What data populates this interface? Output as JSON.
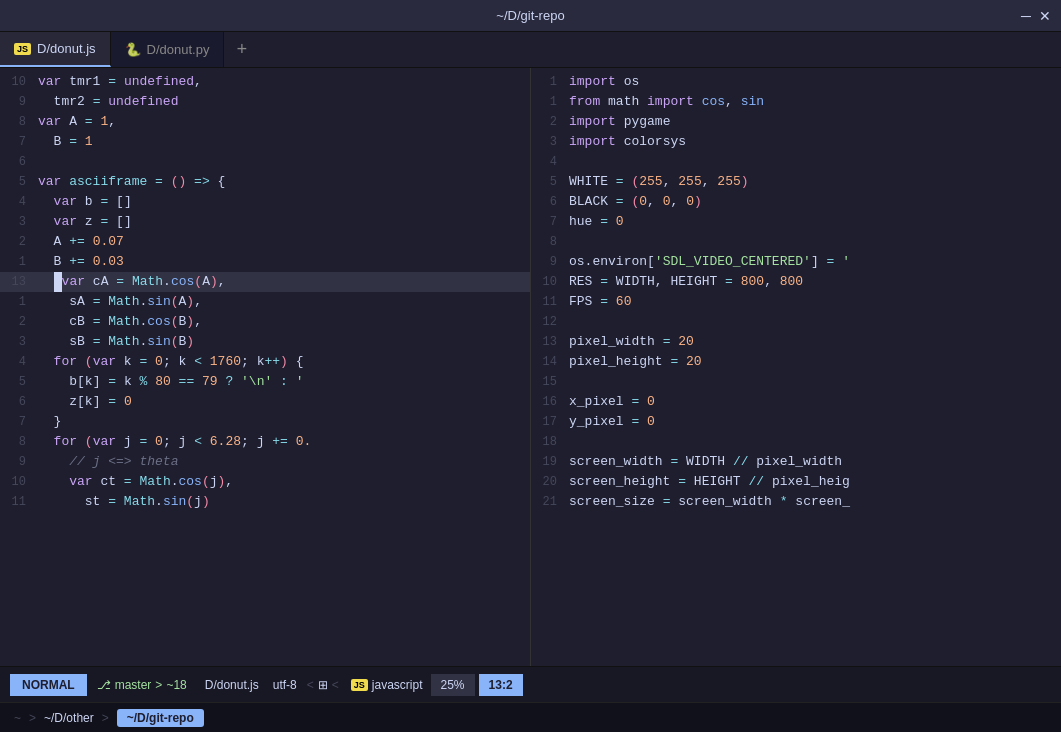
{
  "window": {
    "title": "~/D/git-repo",
    "minimize": "─",
    "close": "✕"
  },
  "tabs": [
    {
      "id": "js-tab",
      "icon": "JS",
      "label": "D/donut.js",
      "active": true
    },
    {
      "id": "py-tab",
      "icon": "🐍",
      "label": "D/donut.py",
      "active": false
    },
    {
      "id": "plus",
      "label": "+"
    }
  ],
  "left_pane": {
    "lines": [
      {
        "num": "10",
        "content": "var tmr1 = undefined,"
      },
      {
        "num": "9",
        "content": "  tmr2 = undefined"
      },
      {
        "num": "8",
        "content": "var A = 1,"
      },
      {
        "num": "7",
        "content": "  B = 1"
      },
      {
        "num": "6",
        "content": ""
      },
      {
        "num": "5",
        "content": "var asciiframe = () => {"
      },
      {
        "num": "4",
        "content": "  var b = []"
      },
      {
        "num": "3",
        "content": "  var z = []"
      },
      {
        "num": "2",
        "content": "  A += 0.07"
      },
      {
        "num": "1",
        "content": "  B += 0.03"
      },
      {
        "num": "13",
        "content": "  var cA = Math.cos(A),",
        "highlight": true
      },
      {
        "num": "1",
        "content": "    sA = Math.sin(A),"
      },
      {
        "num": "2",
        "content": "    cB = Math.cos(B),"
      },
      {
        "num": "3",
        "content": "    sB = Math.sin(B)"
      },
      {
        "num": "4",
        "content": "  for (var k = 0; k < 1760; k++) {"
      },
      {
        "num": "5",
        "content": "    b[k] = k % 80 == 79 ? '\\n' : '"
      },
      {
        "num": "6",
        "content": "    z[k] = 0"
      },
      {
        "num": "7",
        "content": "  }"
      },
      {
        "num": "8",
        "content": "  for (var j = 0; j < 6.28; j += 0."
      },
      {
        "num": "9",
        "content": "    // j <=> theta"
      },
      {
        "num": "10",
        "content": "    var ct = Math.cos(j),"
      },
      {
        "num": "11",
        "content": "      st = Math.sin(j)"
      }
    ]
  },
  "right_pane": {
    "lines": [
      {
        "num": "1",
        "content": "import os"
      },
      {
        "num": "1",
        "content": "from math import cos, sin"
      },
      {
        "num": "2",
        "content": "import pygame"
      },
      {
        "num": "3",
        "content": "import colorsys"
      },
      {
        "num": "4",
        "content": ""
      },
      {
        "num": "5",
        "content": "WHITE = (255, 255, 255)"
      },
      {
        "num": "6",
        "content": "BLACK = (0, 0, 0)"
      },
      {
        "num": "7",
        "content": "hue = 0"
      },
      {
        "num": "8",
        "content": ""
      },
      {
        "num": "9",
        "content": "os.environ['SDL_VIDEO_CENTERED'] = '"
      },
      {
        "num": "10",
        "content": "RES = WIDTH, HEIGHT = 800, 800"
      },
      {
        "num": "11",
        "content": "FPS = 60"
      },
      {
        "num": "12",
        "content": ""
      },
      {
        "num": "13",
        "content": "pixel_width = 20"
      },
      {
        "num": "14",
        "content": "pixel_height = 20"
      },
      {
        "num": "15",
        "content": ""
      },
      {
        "num": "16",
        "content": "x_pixel = 0"
      },
      {
        "num": "17",
        "content": "y_pixel = 0"
      },
      {
        "num": "18",
        "content": ""
      },
      {
        "num": "19",
        "content": "screen_width = WIDTH // pixel_width"
      },
      {
        "num": "20",
        "content": "screen_height = HEIGHT // pixel_heig"
      },
      {
        "num": "21",
        "content": "screen_size = screen_width * screen_"
      }
    ]
  },
  "status": {
    "mode": "NORMAL",
    "git_icon": "⎇",
    "branch": "master",
    "arrow": ">",
    "line_count": "~18",
    "filename": "D/donut.js",
    "encoding": "utf-8",
    "lt": "<",
    "win_icon": "⊞",
    "js_badge": "JS",
    "lang": "javascript",
    "percent": "25%",
    "position": "13:2"
  },
  "terminal": {
    "tilde": "~",
    "sep1": ">",
    "path1": "~/D/other",
    "sep2": ">",
    "active_path": "~/D/git-repo"
  }
}
